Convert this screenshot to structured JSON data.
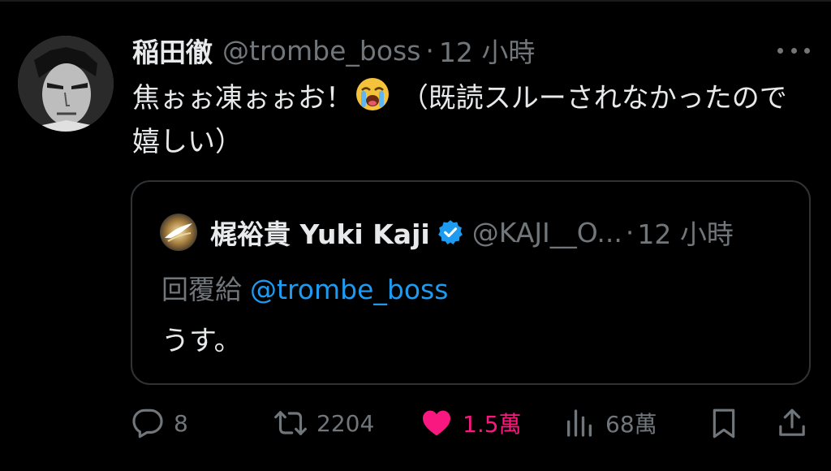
{
  "tweet": {
    "author_name": "稲田徹",
    "author_handle": "@trombe_boss",
    "separator": "·",
    "timestamp": "12 小時",
    "text_part1": "焦ぉぉ凍ぉぉお！",
    "emoji": "loudly-crying-face",
    "text_part2": "（既読スルーされなかったので嬉しい）"
  },
  "quote": {
    "author_name": "梶裕貴 Yuki Kaji",
    "verified": true,
    "author_handle": "@KAJI__O...",
    "separator": "·",
    "timestamp": "12 小時",
    "reply_prefix": "回覆給",
    "reply_mention": "@trombe_boss",
    "text": "うす。"
  },
  "actions": {
    "reply_count": "8",
    "retweet_count": "2204",
    "like_count": "1.5萬",
    "views_count": "68萬"
  },
  "icons": [
    "more-icon",
    "reply-icon",
    "retweet-icon",
    "like-icon",
    "views-icon",
    "bookmark-icon",
    "share-icon",
    "verified-badge-icon"
  ],
  "colors": {
    "background": "#000000",
    "text_primary": "#e7e9ea",
    "text_secondary": "#71767b",
    "link": "#1d9bf0",
    "like": "#f91880",
    "border": "#2f3336"
  }
}
